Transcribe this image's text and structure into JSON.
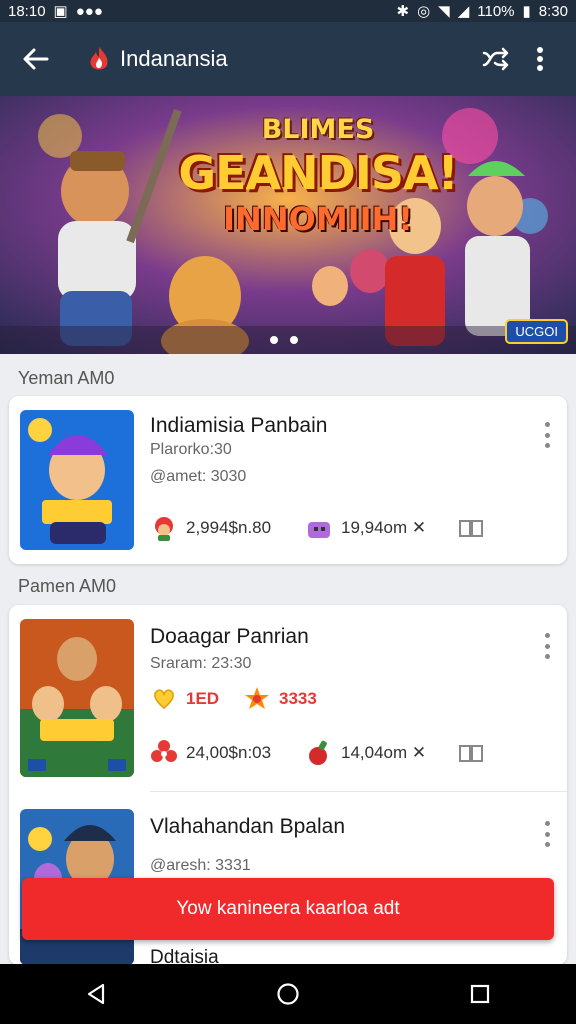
{
  "status_bar": {
    "time": "18:10",
    "battery_text": "110%",
    "clock_right": "8:30"
  },
  "app_bar": {
    "title": "Indanansia"
  },
  "hero": {
    "line1": "BLIMES",
    "line2": "GEANDISA!",
    "line3": "INNOMIIH!",
    "badge": "UCGOI"
  },
  "sections": [
    {
      "label": "Yeman AM0",
      "items": [
        {
          "title": "Indiamisia Panbain",
          "line1": "Plarorko:30",
          "line2": "@amet: 3030",
          "stats": [
            "2,994$n.80",
            "19,94om ✕"
          ]
        }
      ]
    },
    {
      "label": "Pamen AM0",
      "items": [
        {
          "title": "Doaagar Panrian",
          "line1": "Sraram: 23:30",
          "badges": [
            "1ED",
            "3333"
          ],
          "stats": [
            "24,00$n:03",
            "14,04om ✕"
          ]
        },
        {
          "title": "Vlahahandan Bpalan",
          "line2": "@aresh: 3331",
          "partial_text": "Ddtaisia"
        }
      ]
    }
  ],
  "cta": {
    "label": "Yow kanineera kaarloa adt"
  },
  "colors": {
    "app_bar": "#26384c",
    "cta": "#f02a2a"
  }
}
